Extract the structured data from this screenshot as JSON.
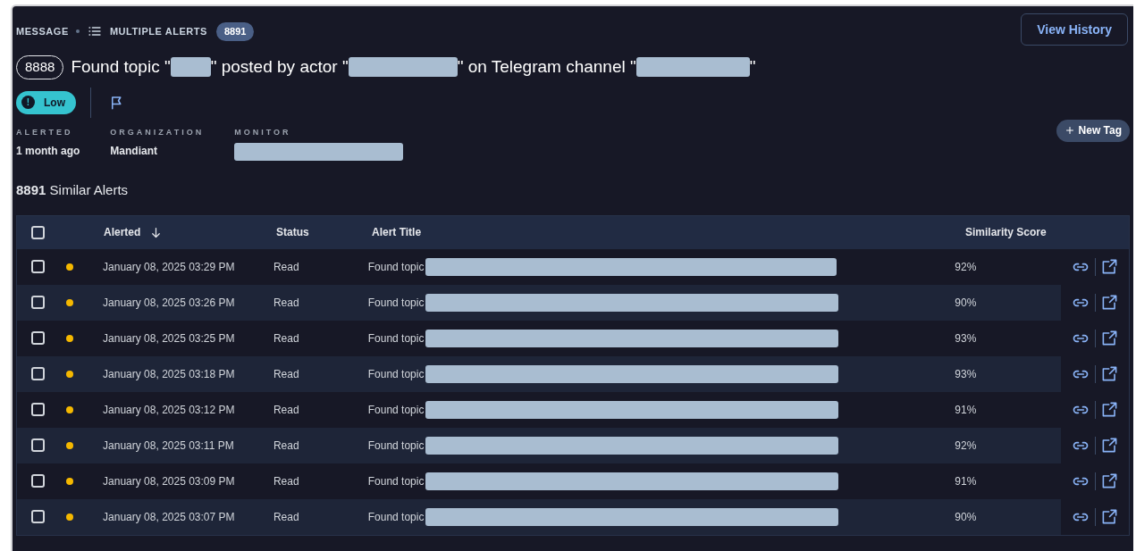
{
  "breadcrumb": {
    "type": "MESSAGE",
    "group": "MULTIPLE ALERTS",
    "count": "8891"
  },
  "view_history": "View History",
  "title": {
    "id": "8888",
    "parts": [
      "Found topic \"",
      "\" posted by actor \"",
      "\" on Telegram channel \"",
      "\""
    ]
  },
  "severity": {
    "label": "Low",
    "icon": "!"
  },
  "meta": [
    {
      "label": "ALERTED",
      "value": "1 month ago"
    },
    {
      "label": "ORGANIZATION",
      "value": "Mandiant"
    },
    {
      "label": "MONITOR",
      "redacted": true
    }
  ],
  "new_tag": "New Tag",
  "similar": {
    "count": "8891",
    "label": "Similar Alerts"
  },
  "table": {
    "header_checked": false,
    "columns": [
      "Alerted",
      "Status",
      "Alert Title",
      "Similarity Score"
    ],
    "rows": [
      {
        "checked": false,
        "color": "#f5b800",
        "alerted": "January 08, 2025 03:29 PM",
        "status": "Read",
        "title": "Found topic",
        "score": "92%"
      },
      {
        "checked": false,
        "color": "#f5b800",
        "alerted": "January 08, 2025 03:26 PM",
        "status": "Read",
        "title": "Found topic",
        "score": "90%"
      },
      {
        "checked": false,
        "color": "#f5b800",
        "alerted": "January 08, 2025 03:25 PM",
        "status": "Read",
        "title": "Found topic",
        "score": "93%"
      },
      {
        "checked": false,
        "color": "#f5b800",
        "alerted": "January 08, 2025 03:18 PM",
        "status": "Read",
        "title": "Found topic",
        "score": "93%"
      },
      {
        "checked": false,
        "color": "#f5b800",
        "alerted": "January 08, 2025 03:12 PM",
        "status": "Read",
        "title": "Found topic",
        "score": "91%"
      },
      {
        "checked": false,
        "color": "#f5b800",
        "alerted": "January 08, 2025 03:11 PM",
        "status": "Read",
        "title": "Found topic",
        "score": "92%"
      },
      {
        "checked": false,
        "color": "#f5b800",
        "alerted": "January 08, 2025 03:09 PM",
        "status": "Read",
        "title": "Found topic",
        "score": "91%"
      },
      {
        "checked": false,
        "color": "#f5b800",
        "alerted": "January 08, 2025 03:07 PM",
        "status": "Read",
        "title": "Found topic",
        "score": "90%"
      }
    ]
  }
}
